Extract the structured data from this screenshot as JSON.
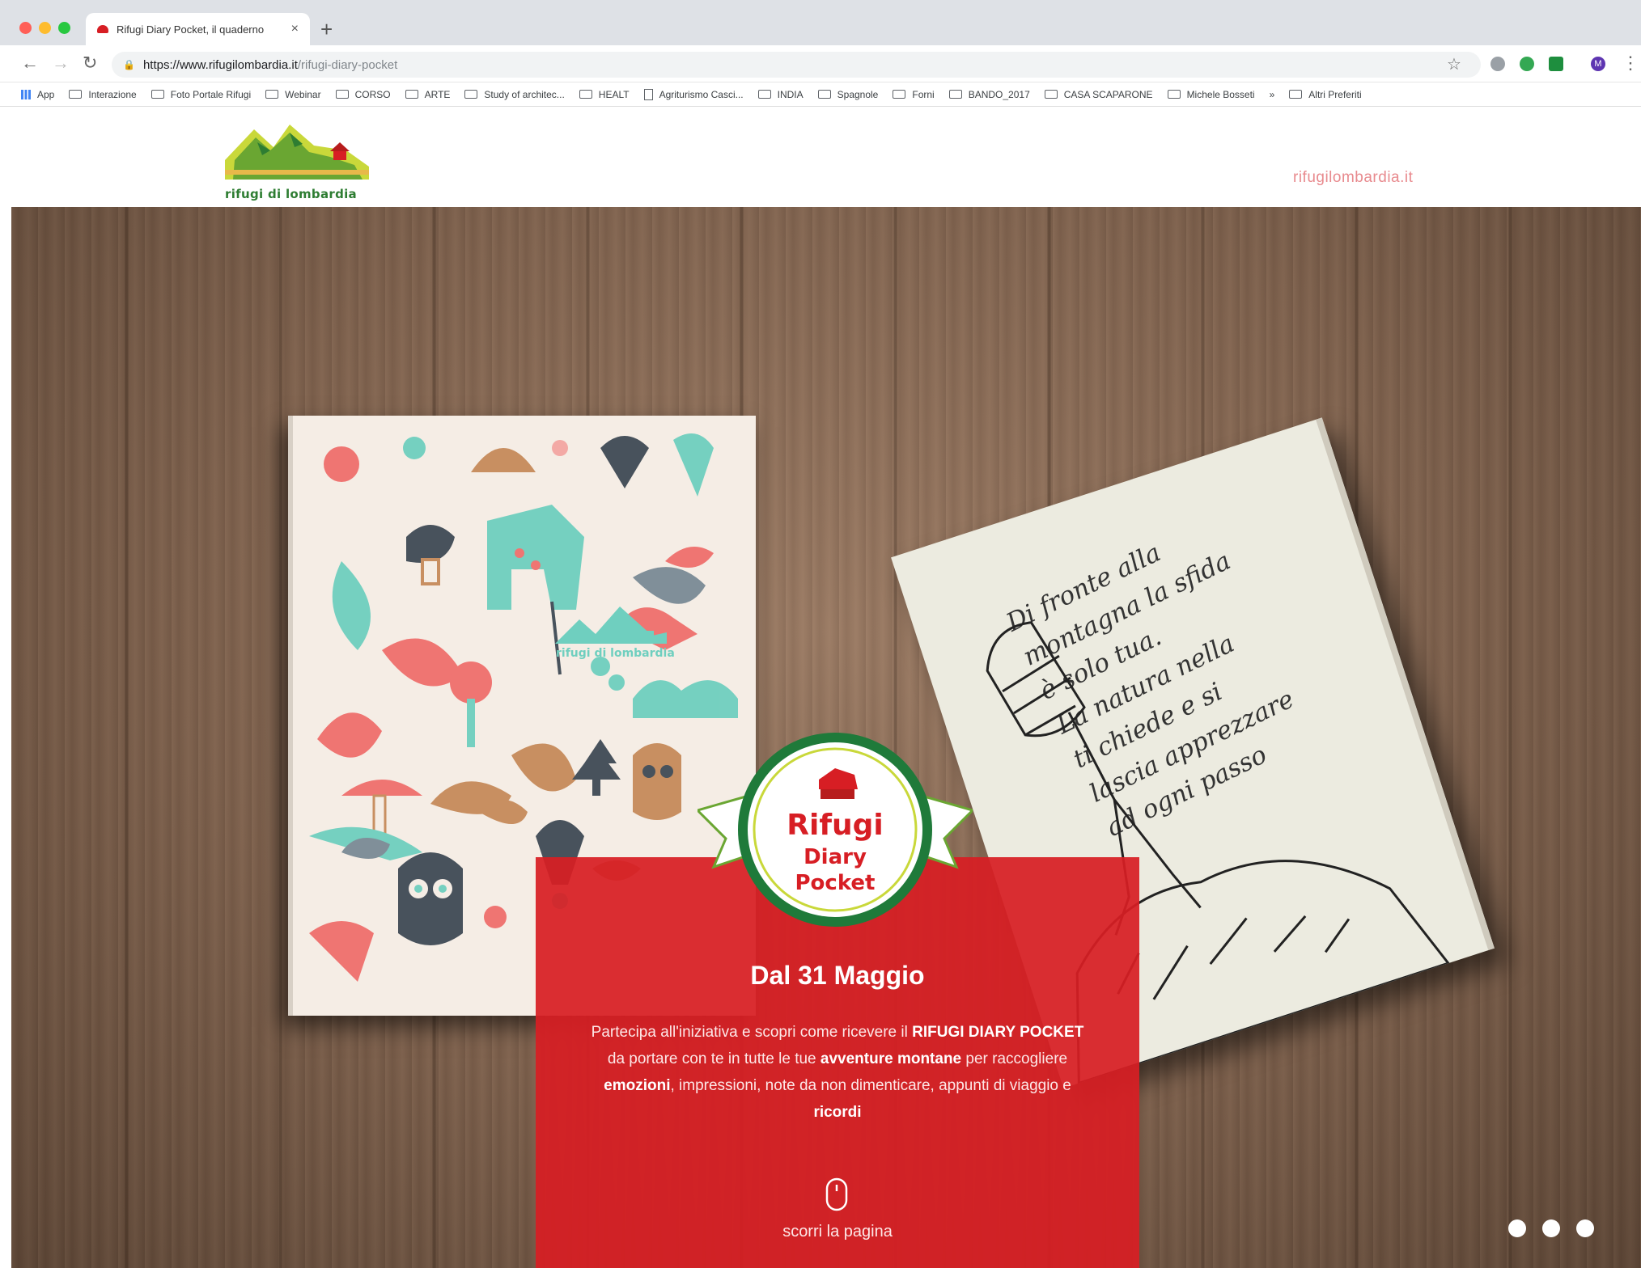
{
  "browser": {
    "tab_title": "Rifugi Diary Pocket, il quaderno",
    "url_domain": "https://www.rifugilombardia.it",
    "url_path": "/rifugi-diary-pocket",
    "bookmarks": [
      "App",
      "Interazione",
      "Foto Portale Rifugi",
      "Webinar",
      "CORSO",
      "ARTE",
      "Study of architec...",
      "HEALT",
      "Agriturismo Casci...",
      "INDIA",
      "Spagnole",
      "Forni",
      "BANDO_2017",
      "CASA SCAPARONE",
      "Michele Bosseti",
      "Altri Preferiti"
    ],
    "profile_initial": "M"
  },
  "site": {
    "logo_text": "rifugi di lombardia",
    "header_link": "rifugilombardia.it"
  },
  "hero": {
    "notebook_quote": [
      "Di fronte alla",
      "montagna la sfida",
      "è solo tua.",
      "La natura nella",
      "ti chiede e si",
      "lascia apprezzare",
      "ad ogni passo"
    ],
    "notebook_logo": "rifugi di lombardia",
    "badge_line1": "Rifugi",
    "badge_line2": "Diary",
    "badge_line3": "Pocket",
    "date": "Dal 31 Maggio",
    "desc_1": "Partecipa all'iniziativa e scopri come ricevere il ",
    "desc_b1": "RIFUGI DIARY POCKET",
    "desc_2": " da portare con te in tutte le tue ",
    "desc_b2": "avventure montane",
    "desc_3": " per raccogliere ",
    "desc_b3": "emozioni",
    "desc_4": ", impressioni, note da non dimenticare, appunti di viaggio e ",
    "desc_b4": "ricordi",
    "scroll_hint": "scorri la pagina",
    "slides": 3
  },
  "colors": {
    "brand_red": "#d71e24",
    "brand_green": "#6aa632",
    "badge_green": "#2e7d32"
  }
}
